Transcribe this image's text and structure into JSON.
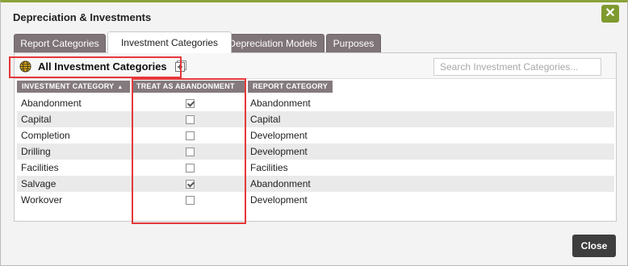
{
  "dialog": {
    "title": "Depreciation & Investments",
    "close_icon": "close-x-icon"
  },
  "tabs": [
    {
      "label": "Report Categories",
      "active": false
    },
    {
      "label": "Investment Categories",
      "active": true
    },
    {
      "label": "Depreciation Models",
      "active": false
    },
    {
      "label": "Purposes",
      "active": false
    }
  ],
  "toolbar": {
    "all_categories_label": "All Investment Categories",
    "globe_icon": "globe-icon",
    "add_icon": "add-category-icon",
    "search_placeholder": "Search Investment Categories..."
  },
  "table": {
    "columns": [
      "INVESTMENT CATEGORY",
      "TREAT AS ABANDONMENT",
      "REPORT CATEGORY"
    ],
    "sort_indicator": "▲",
    "rows": [
      {
        "category": "Abandonment",
        "treat_as_abandonment": true,
        "report_category": "Abandonment"
      },
      {
        "category": "Capital",
        "treat_as_abandonment": false,
        "report_category": "Capital"
      },
      {
        "category": "Completion",
        "treat_as_abandonment": false,
        "report_category": "Development"
      },
      {
        "category": "Drilling",
        "treat_as_abandonment": false,
        "report_category": "Development"
      },
      {
        "category": "Facilities",
        "treat_as_abandonment": false,
        "report_category": "Facilities"
      },
      {
        "category": "Salvage",
        "treat_as_abandonment": true,
        "report_category": "Abandonment"
      },
      {
        "category": "Workover",
        "treat_as_abandonment": false,
        "report_category": "Development"
      }
    ]
  },
  "footer": {
    "close_label": "Close"
  },
  "colors": {
    "accent": "#7f9a2f",
    "tab_inactive": "#7f7477",
    "header_bg": "#847a7d",
    "highlight": "#e5383b",
    "close_button": "#3e3e3e"
  }
}
